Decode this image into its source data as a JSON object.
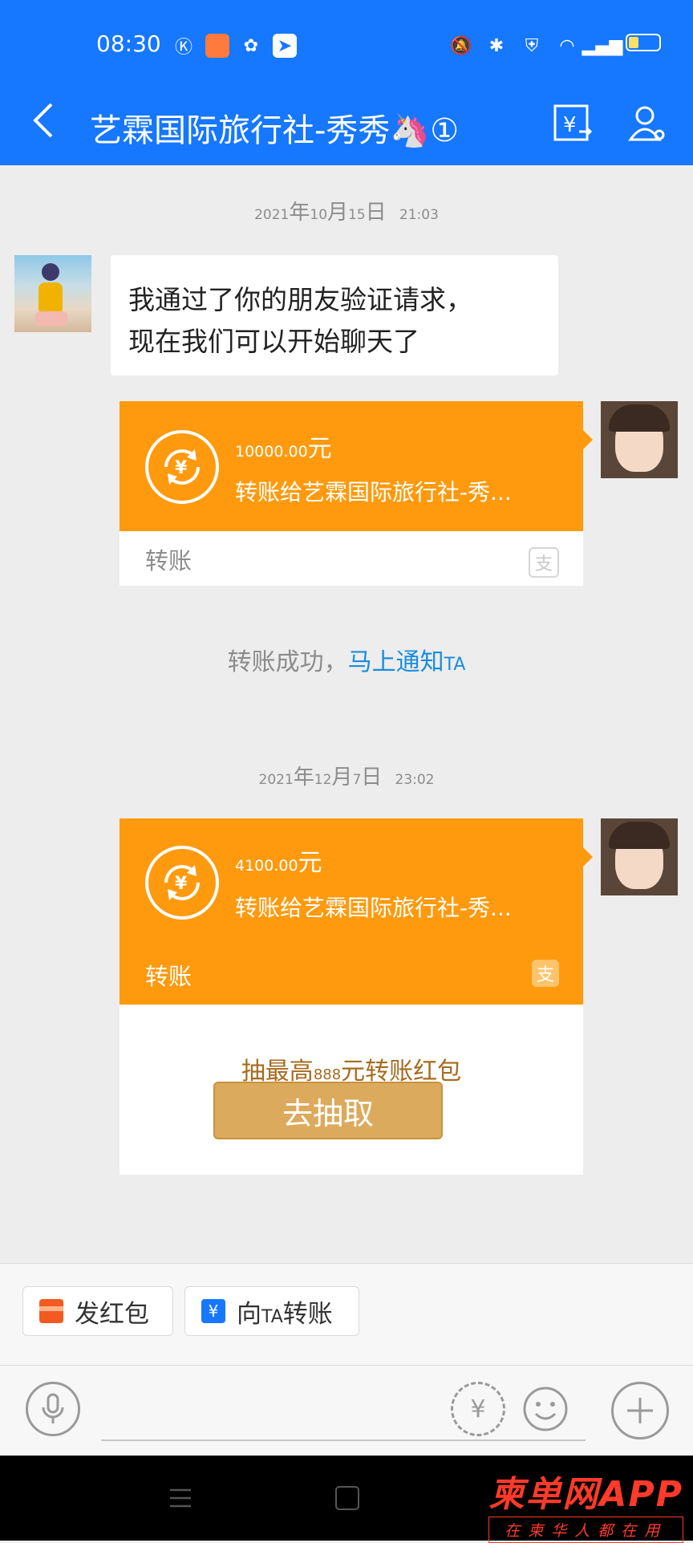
{
  "status_bar": {
    "time": "08:30"
  },
  "header": {
    "title": "艺霖国际旅行社-秀秀🦄①"
  },
  "messages": [
    {
      "type": "timestamp",
      "year": "2021",
      "y": "年",
      "month": "10",
      "m": "月",
      "day": "15",
      "d": "日",
      "time": "21:03"
    },
    {
      "type": "text",
      "lines": [
        "我通过了你的朋友验证请求，",
        "现在我们可以开始聊天了"
      ]
    },
    {
      "type": "transfer",
      "amount": "10000.00",
      "unit": "元",
      "desc": "转账给艺霖国际旅行社-秀...",
      "label": "转账"
    },
    {
      "type": "notice",
      "text": "转账成功，",
      "link": "马上通知",
      "link_suffix": "TA"
    },
    {
      "type": "timestamp",
      "year": "2021",
      "y": "年",
      "month": "12",
      "m": "月",
      "day": "7",
      "d": "日",
      "time": "23:02"
    },
    {
      "type": "transfer",
      "amount": "4100.00",
      "unit": "元",
      "desc": "转账给艺霖国际旅行社-秀...",
      "label": "转账",
      "lottery_prefix": "抽最高",
      "lottery_amount": "888",
      "lottery_suffix": "元转账红包",
      "button": "去抽取"
    }
  ],
  "quick_actions": [
    {
      "label": "发红包"
    },
    {
      "prefix": "向",
      "small": "TA",
      "suffix": "转账"
    }
  ],
  "watermark": {
    "brand": "柬单网APP",
    "slogan": "在柬华人都在用"
  },
  "colors": {
    "header": "#1677ff",
    "transfer": "#ff9a0e",
    "link": "#1a8ce0"
  }
}
